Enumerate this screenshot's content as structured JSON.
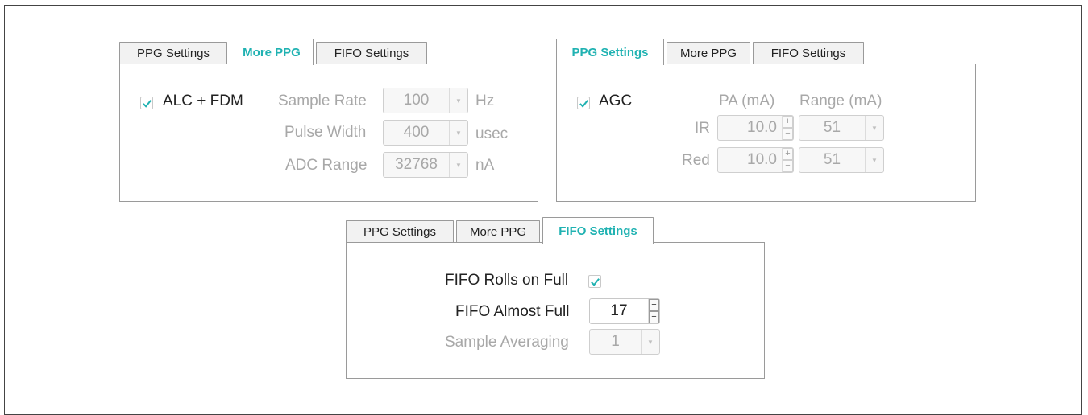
{
  "tabs": [
    "PPG Settings",
    "More PPG",
    "FIFO Settings"
  ],
  "more_ppg": {
    "alc_fdm": {
      "label": "ALC + FDM",
      "checked": true
    },
    "sample_rate": {
      "label": "Sample Rate",
      "value": "100",
      "unit": "Hz"
    },
    "pulse_width": {
      "label": "Pulse Width",
      "value": "400",
      "unit": "usec"
    },
    "adc_range": {
      "label": "ADC Range",
      "value": "32768",
      "unit": "nA"
    }
  },
  "ppg_settings": {
    "agc": {
      "label": "AGC",
      "checked": true
    },
    "pa_header": "PA (mA)",
    "range_header": "Range (mA)",
    "ir": {
      "label": "IR",
      "pa": "10.0",
      "range": "51"
    },
    "red": {
      "label": "Red",
      "pa": "10.0",
      "range": "51"
    }
  },
  "fifo_settings": {
    "rolls_on_full": {
      "label": "FIFO Rolls on Full",
      "checked": true
    },
    "almost_full": {
      "label": "FIFO Almost Full",
      "value": "17"
    },
    "sample_averaging": {
      "label": "Sample Averaging",
      "value": "1"
    }
  },
  "spin_plus": "+",
  "spin_minus": "−",
  "colors": {
    "accent": "#20b2b2",
    "disabled_text": "#a8a8a8",
    "border": "#9a9a9a"
  }
}
